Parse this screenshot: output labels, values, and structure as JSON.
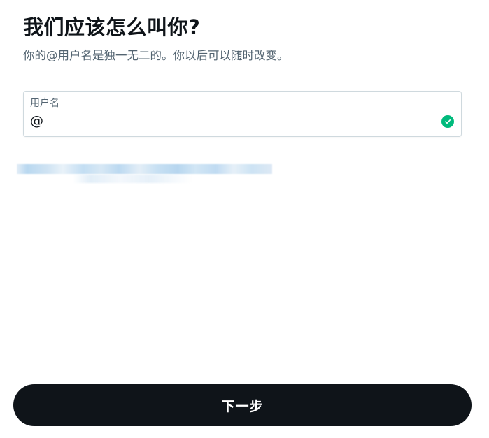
{
  "header": {
    "title": "我们应该怎么叫你?",
    "subtitle": "你的@用户名是独一无二的。你以后可以随时改变。"
  },
  "username_field": {
    "label": "用户名",
    "prefix": "@",
    "value": "",
    "status_icon": "check-circle-icon",
    "status_color": "#00ba7c",
    "border_color": "#cfd9de"
  },
  "footer": {
    "next_label": "下一步",
    "button_color": "#0f1419"
  }
}
